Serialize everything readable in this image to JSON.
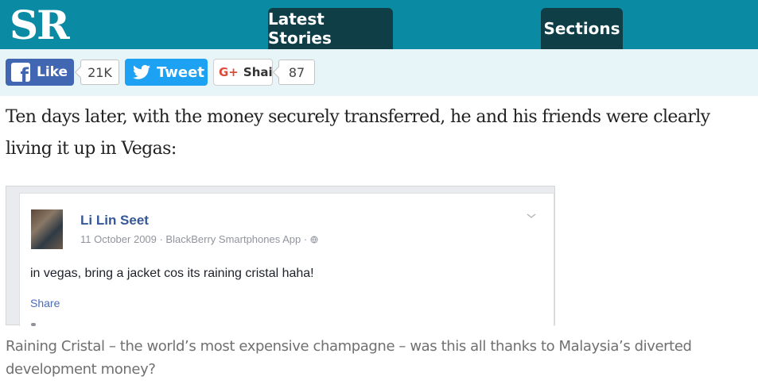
{
  "header": {
    "logo": "SR",
    "tabs": [
      "Latest Stories",
      "Sections"
    ],
    "bg_color": "#0a8ba3",
    "tab_color": "#0f3e47"
  },
  "social": {
    "facebook": {
      "label": "Like",
      "count": "21K",
      "icon": "facebook-icon"
    },
    "twitter": {
      "label": "Tweet",
      "icon": "twitter-bird-icon"
    },
    "google": {
      "icon_text": "G+",
      "label": "Shai",
      "count": "87"
    }
  },
  "article": {
    "paragraph": "Ten days later, with the money securely transferred, he and his friends were clearly living it up in Vegas:",
    "caption": "Raining Cristal – the world’s most expensive champagne – was this all thanks to Malaysia’s diverted development money?"
  },
  "embed": {
    "poster_name": "Li Lin Seet",
    "meta": "11 October 2009 · BlackBerry Smartphones App · ",
    "post_text": "in vegas, bring a jacket cos its raining cristal haha!",
    "share_label": "Share"
  }
}
